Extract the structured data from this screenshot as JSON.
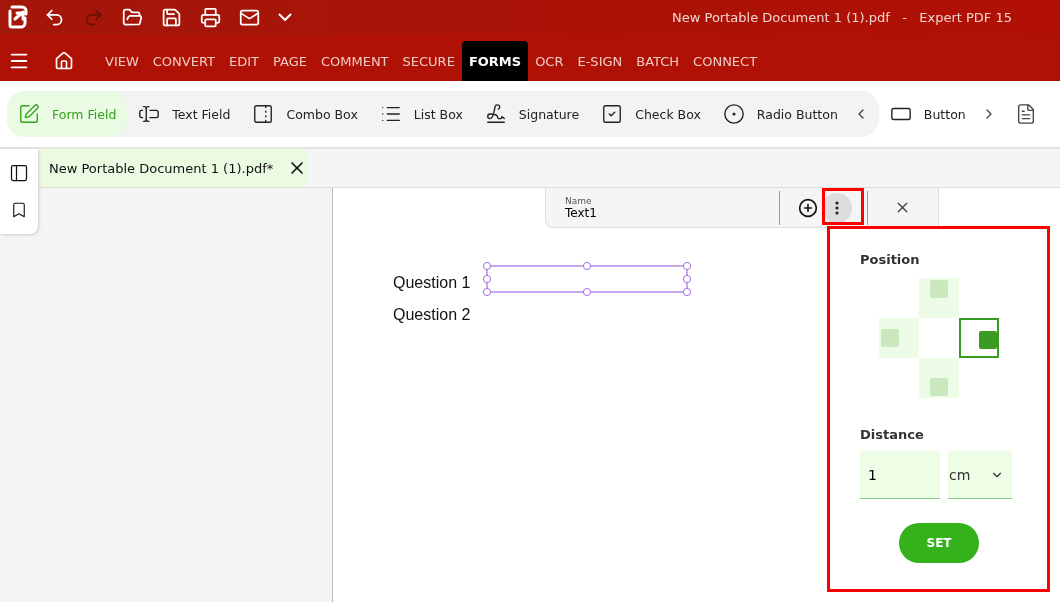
{
  "window": {
    "title": "New Portable Document 1 (1).pdf   -   Expert PDF 15"
  },
  "quick_access": [
    {
      "kind": "undo",
      "disabled": false
    },
    {
      "kind": "redo",
      "disabled": true
    },
    {
      "kind": "open",
      "disabled": false
    },
    {
      "kind": "save",
      "disabled": false
    },
    {
      "kind": "print",
      "disabled": false
    },
    {
      "kind": "mail",
      "disabled": false
    },
    {
      "kind": "more",
      "disabled": false
    }
  ],
  "tabs": [
    {
      "label": "VIEW",
      "selected": false
    },
    {
      "label": "CONVERT",
      "selected": false
    },
    {
      "label": "EDIT",
      "selected": false
    },
    {
      "label": "PAGE",
      "selected": false
    },
    {
      "label": "COMMENT",
      "selected": false
    },
    {
      "label": "SECURE",
      "selected": false
    },
    {
      "label": "FORMS",
      "selected": true
    },
    {
      "label": "OCR",
      "selected": false
    },
    {
      "label": "E-SIGN",
      "selected": false
    },
    {
      "label": "BATCH",
      "selected": false
    },
    {
      "label": "CONNECT",
      "selected": false
    }
  ],
  "toolbar": [
    {
      "kind": "form_field",
      "label": "Form Field",
      "selected": true
    },
    {
      "kind": "text_field",
      "label": "Text Field",
      "selected": false
    },
    {
      "kind": "combo_box",
      "label": "Combo Box",
      "selected": false
    },
    {
      "kind": "list_box",
      "label": "List Box",
      "selected": false
    },
    {
      "kind": "signature",
      "label": "Signature",
      "selected": false
    },
    {
      "kind": "check_box",
      "label": "Check Box",
      "selected": false
    },
    {
      "kind": "radio_button",
      "label": "Radio Button",
      "selected": false
    }
  ],
  "toolbar_more": [
    {
      "kind": "button",
      "label": "Button",
      "selected": false
    }
  ],
  "document_tab": {
    "label": "New Portable Document 1 (1).pdf*"
  },
  "page": {
    "lines": [
      "Question 1",
      "Question 2"
    ]
  },
  "field_bar": {
    "name_label": "Name",
    "name_value": "Text1"
  },
  "popup": {
    "position_label": "Position",
    "positions": [
      {
        "kind": "top",
        "selected": false
      },
      {
        "kind": "left",
        "selected": false
      },
      {
        "kind": "right",
        "selected": true
      },
      {
        "kind": "bottom",
        "selected": false
      }
    ],
    "distance_label": "Distance",
    "distance_value": "1",
    "unit": "cm",
    "set_button": "SET"
  }
}
